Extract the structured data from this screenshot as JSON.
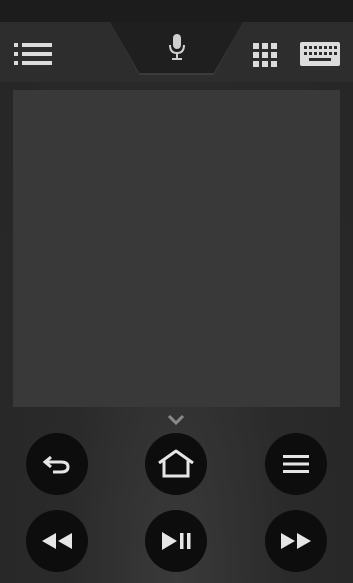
{
  "header": {
    "list_icon": "list-icon",
    "mic_icon": "microphone-icon",
    "grid_icon": "grid-icon",
    "keyboard_icon": "keyboard-icon"
  },
  "touchpad": {
    "icon": "expand-chevron-icon"
  },
  "controls": {
    "row1": [
      "back-icon",
      "home-icon",
      "menu-icon"
    ],
    "row2": [
      "rewind-icon",
      "play-pause-icon",
      "fast-forward-icon"
    ]
  },
  "colors": {
    "background": "#2a2a2a",
    "button": "#0d0d0d",
    "icon": "#dcdcdc",
    "touchpad": "#393939"
  }
}
